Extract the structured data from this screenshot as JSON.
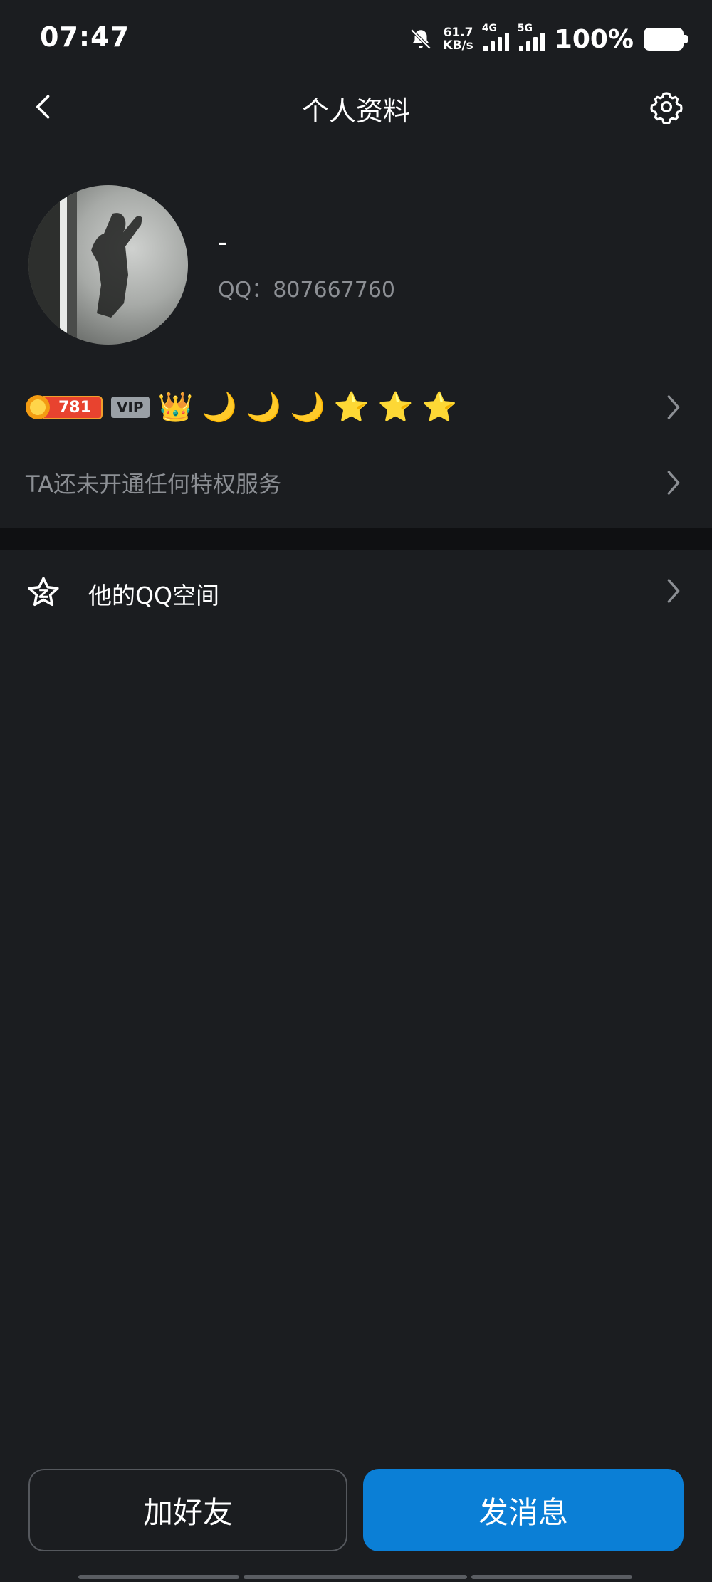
{
  "status_bar": {
    "time": "07:47",
    "net_speed_value": "61.7",
    "net_speed_unit": "KB/s",
    "signal1": "4G",
    "signal2": "5G",
    "battery": "100%",
    "icons": [
      "mute-bell-icon",
      "signal-icon",
      "battery-icon"
    ]
  },
  "nav": {
    "title": "个人资料",
    "back_icon": "chevron-left-icon",
    "settings_icon": "gear-icon"
  },
  "profile": {
    "nickname": "-",
    "qq_label": "QQ：807667760"
  },
  "badges": {
    "coin_value": "781",
    "vip": "VIP",
    "level_icons": [
      "👑",
      "🌙",
      "🌙",
      "🌙",
      "⭐",
      "⭐",
      "⭐"
    ]
  },
  "privilege": {
    "text": "TA还未开通任何特权服务"
  },
  "qzone": {
    "label": "他的QQ空间",
    "icon": "qzone-star-icon"
  },
  "actions": {
    "add_friend": "加好友",
    "send_message": "发消息"
  },
  "colors": {
    "background": "#1b1d20",
    "primary_button": "#0b7fd6",
    "muted_text": "#8c8f94"
  }
}
